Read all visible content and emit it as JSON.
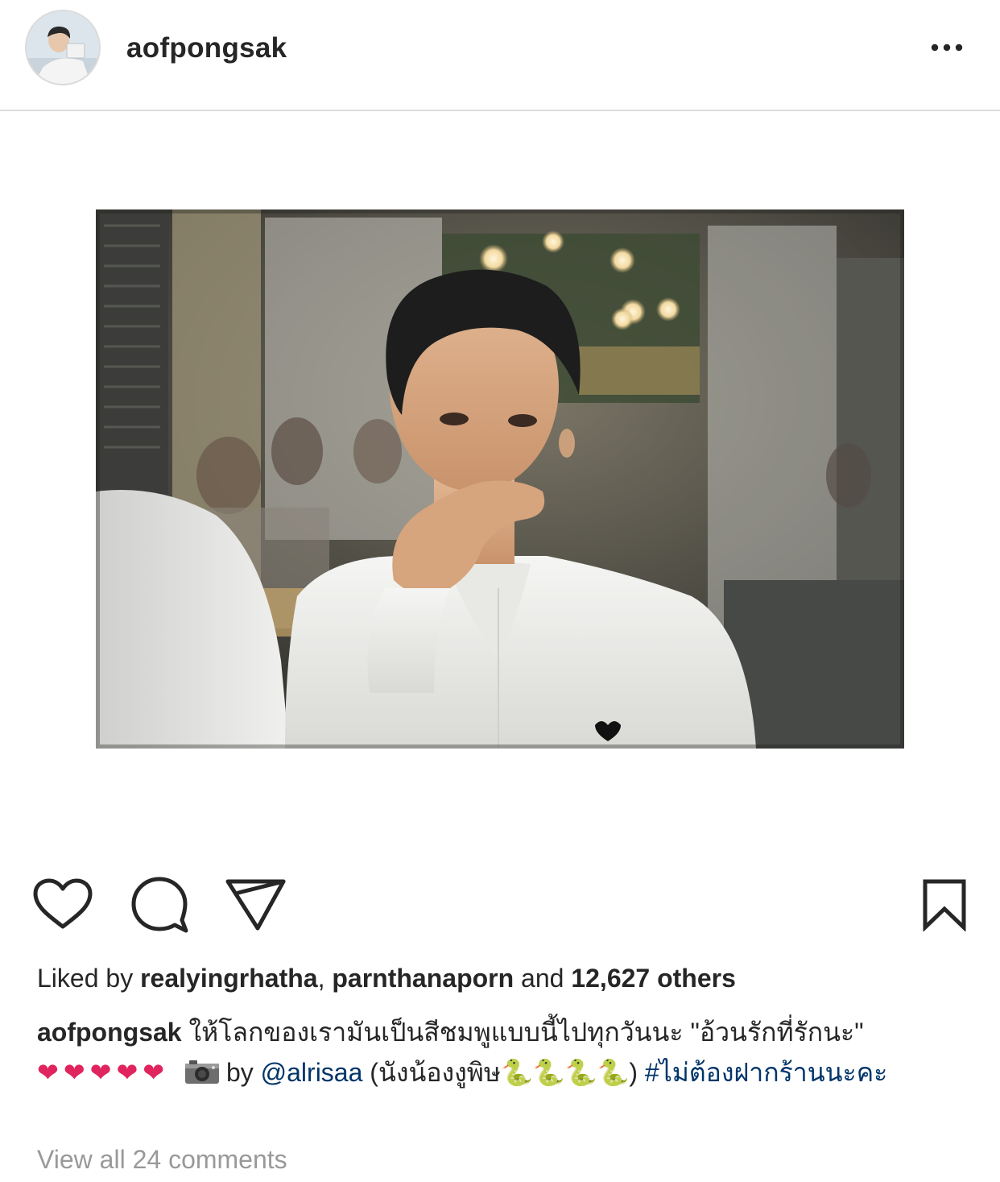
{
  "header": {
    "username": "aofpongsak"
  },
  "likes": {
    "prefix": "Liked by ",
    "user1": "realyingrhatha",
    "separator": ", ",
    "user2": "parnthanaporn",
    "middle": " and ",
    "others": "12,627 others"
  },
  "caption": {
    "username": "aofpongsak",
    "text": "ให้โลกของเรามันเป็นสีชมพูแบบนี้ไปทุกวันนะ \"อ้วนรักที่รักนะ\"",
    "hearts": "❤❤❤❤❤",
    "by": "by",
    "mention": "@alrisaa",
    "paren_text": "(นังน้องงูพิษ",
    "snakes": "🐍🐍🐍🐍",
    "paren_close": ")",
    "hashtag": "#ไม่ต้องฝากร้านนะคะ"
  },
  "comments": {
    "view_all": "View all 24 comments"
  },
  "icons": {
    "like": "heart-icon",
    "comment": "comment-bubble-icon",
    "share": "paper-plane-icon",
    "save": "bookmark-icon",
    "more": "more-dots-icon",
    "camera": "camera-icon"
  },
  "colors": {
    "text": "#262626",
    "link": "#003569",
    "muted": "#999999",
    "divider": "#dbdbdb",
    "heart": "#e0245e"
  }
}
